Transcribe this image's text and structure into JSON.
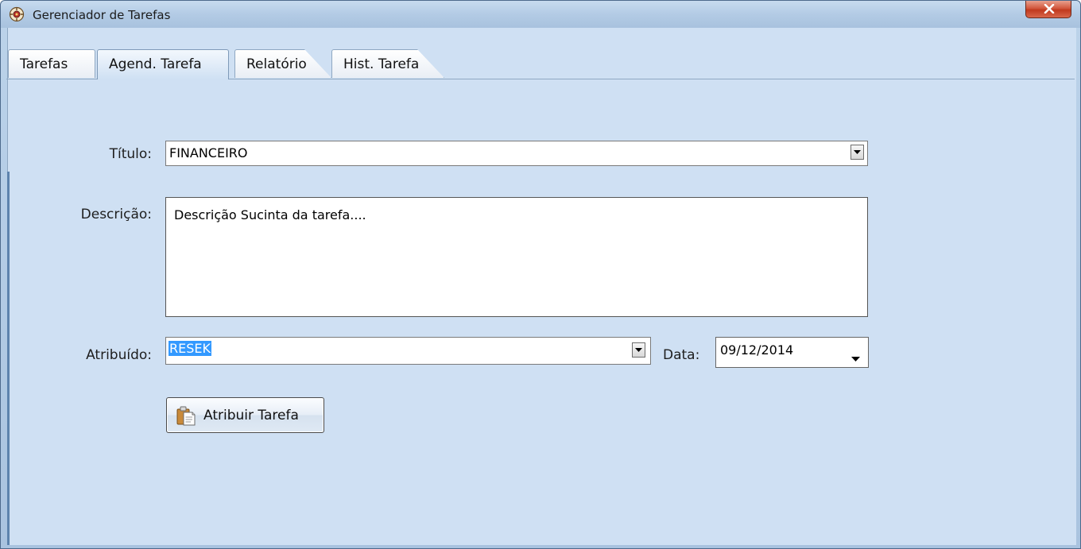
{
  "window": {
    "title": "Gerenciador de Tarefas",
    "app_icon": "task-manager-icon",
    "close_icon": "close-icon",
    "colors": {
      "client_bg": "#cfe0f3",
      "close_button": "#c0391e",
      "selection": "#3399ff"
    }
  },
  "tabs": [
    {
      "label": "Tarefas",
      "active": false
    },
    {
      "label": "Agend. Tarefa",
      "active": true
    },
    {
      "label": "Relatório",
      "active": false
    },
    {
      "label": "Hist. Tarefa",
      "active": false
    }
  ],
  "form": {
    "titulo": {
      "label": "Título:",
      "value": "FINANCEIRO",
      "dropdown_icon": "chevron-down-icon"
    },
    "descricao": {
      "label": "Descrição:",
      "value": "Descrição Sucinta da tarefa...."
    },
    "atribuido": {
      "label": "Atribuído:",
      "value": "RESEK",
      "selected": true,
      "dropdown_icon": "chevron-down-icon"
    },
    "data": {
      "label": "Data:",
      "value": "09/12/2014",
      "dropdown_icon": "chevron-down-icon"
    },
    "submit": {
      "label": "Atribuir Tarefa",
      "icon": "clipboard-icon"
    }
  }
}
